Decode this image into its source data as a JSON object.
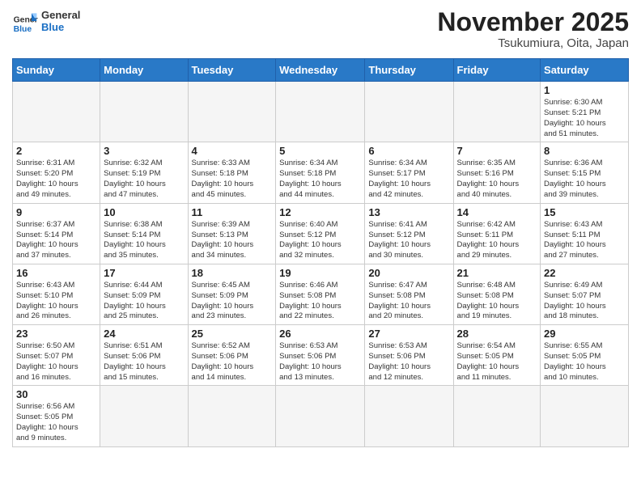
{
  "header": {
    "logo_general": "General",
    "logo_blue": "Blue",
    "month_title": "November 2025",
    "location": "Tsukumiura, Oita, Japan"
  },
  "weekdays": [
    "Sunday",
    "Monday",
    "Tuesday",
    "Wednesday",
    "Thursday",
    "Friday",
    "Saturday"
  ],
  "weeks": [
    [
      {
        "day": "",
        "info": ""
      },
      {
        "day": "",
        "info": ""
      },
      {
        "day": "",
        "info": ""
      },
      {
        "day": "",
        "info": ""
      },
      {
        "day": "",
        "info": ""
      },
      {
        "day": "",
        "info": ""
      },
      {
        "day": "1",
        "info": "Sunrise: 6:30 AM\nSunset: 5:21 PM\nDaylight: 10 hours\nand 51 minutes."
      }
    ],
    [
      {
        "day": "2",
        "info": "Sunrise: 6:31 AM\nSunset: 5:20 PM\nDaylight: 10 hours\nand 49 minutes."
      },
      {
        "day": "3",
        "info": "Sunrise: 6:32 AM\nSunset: 5:19 PM\nDaylight: 10 hours\nand 47 minutes."
      },
      {
        "day": "4",
        "info": "Sunrise: 6:33 AM\nSunset: 5:18 PM\nDaylight: 10 hours\nand 45 minutes."
      },
      {
        "day": "5",
        "info": "Sunrise: 6:34 AM\nSunset: 5:18 PM\nDaylight: 10 hours\nand 44 minutes."
      },
      {
        "day": "6",
        "info": "Sunrise: 6:34 AM\nSunset: 5:17 PM\nDaylight: 10 hours\nand 42 minutes."
      },
      {
        "day": "7",
        "info": "Sunrise: 6:35 AM\nSunset: 5:16 PM\nDaylight: 10 hours\nand 40 minutes."
      },
      {
        "day": "8",
        "info": "Sunrise: 6:36 AM\nSunset: 5:15 PM\nDaylight: 10 hours\nand 39 minutes."
      }
    ],
    [
      {
        "day": "9",
        "info": "Sunrise: 6:37 AM\nSunset: 5:14 PM\nDaylight: 10 hours\nand 37 minutes."
      },
      {
        "day": "10",
        "info": "Sunrise: 6:38 AM\nSunset: 5:14 PM\nDaylight: 10 hours\nand 35 minutes."
      },
      {
        "day": "11",
        "info": "Sunrise: 6:39 AM\nSunset: 5:13 PM\nDaylight: 10 hours\nand 34 minutes."
      },
      {
        "day": "12",
        "info": "Sunrise: 6:40 AM\nSunset: 5:12 PM\nDaylight: 10 hours\nand 32 minutes."
      },
      {
        "day": "13",
        "info": "Sunrise: 6:41 AM\nSunset: 5:12 PM\nDaylight: 10 hours\nand 30 minutes."
      },
      {
        "day": "14",
        "info": "Sunrise: 6:42 AM\nSunset: 5:11 PM\nDaylight: 10 hours\nand 29 minutes."
      },
      {
        "day": "15",
        "info": "Sunrise: 6:43 AM\nSunset: 5:11 PM\nDaylight: 10 hours\nand 27 minutes."
      }
    ],
    [
      {
        "day": "16",
        "info": "Sunrise: 6:43 AM\nSunset: 5:10 PM\nDaylight: 10 hours\nand 26 minutes."
      },
      {
        "day": "17",
        "info": "Sunrise: 6:44 AM\nSunset: 5:09 PM\nDaylight: 10 hours\nand 25 minutes."
      },
      {
        "day": "18",
        "info": "Sunrise: 6:45 AM\nSunset: 5:09 PM\nDaylight: 10 hours\nand 23 minutes."
      },
      {
        "day": "19",
        "info": "Sunrise: 6:46 AM\nSunset: 5:08 PM\nDaylight: 10 hours\nand 22 minutes."
      },
      {
        "day": "20",
        "info": "Sunrise: 6:47 AM\nSunset: 5:08 PM\nDaylight: 10 hours\nand 20 minutes."
      },
      {
        "day": "21",
        "info": "Sunrise: 6:48 AM\nSunset: 5:08 PM\nDaylight: 10 hours\nand 19 minutes."
      },
      {
        "day": "22",
        "info": "Sunrise: 6:49 AM\nSunset: 5:07 PM\nDaylight: 10 hours\nand 18 minutes."
      }
    ],
    [
      {
        "day": "23",
        "info": "Sunrise: 6:50 AM\nSunset: 5:07 PM\nDaylight: 10 hours\nand 16 minutes."
      },
      {
        "day": "24",
        "info": "Sunrise: 6:51 AM\nSunset: 5:06 PM\nDaylight: 10 hours\nand 15 minutes."
      },
      {
        "day": "25",
        "info": "Sunrise: 6:52 AM\nSunset: 5:06 PM\nDaylight: 10 hours\nand 14 minutes."
      },
      {
        "day": "26",
        "info": "Sunrise: 6:53 AM\nSunset: 5:06 PM\nDaylight: 10 hours\nand 13 minutes."
      },
      {
        "day": "27",
        "info": "Sunrise: 6:53 AM\nSunset: 5:06 PM\nDaylight: 10 hours\nand 12 minutes."
      },
      {
        "day": "28",
        "info": "Sunrise: 6:54 AM\nSunset: 5:05 PM\nDaylight: 10 hours\nand 11 minutes."
      },
      {
        "day": "29",
        "info": "Sunrise: 6:55 AM\nSunset: 5:05 PM\nDaylight: 10 hours\nand 10 minutes."
      }
    ],
    [
      {
        "day": "30",
        "info": "Sunrise: 6:56 AM\nSunset: 5:05 PM\nDaylight: 10 hours\nand 9 minutes."
      },
      {
        "day": "",
        "info": ""
      },
      {
        "day": "",
        "info": ""
      },
      {
        "day": "",
        "info": ""
      },
      {
        "day": "",
        "info": ""
      },
      {
        "day": "",
        "info": ""
      },
      {
        "day": "",
        "info": ""
      }
    ]
  ]
}
